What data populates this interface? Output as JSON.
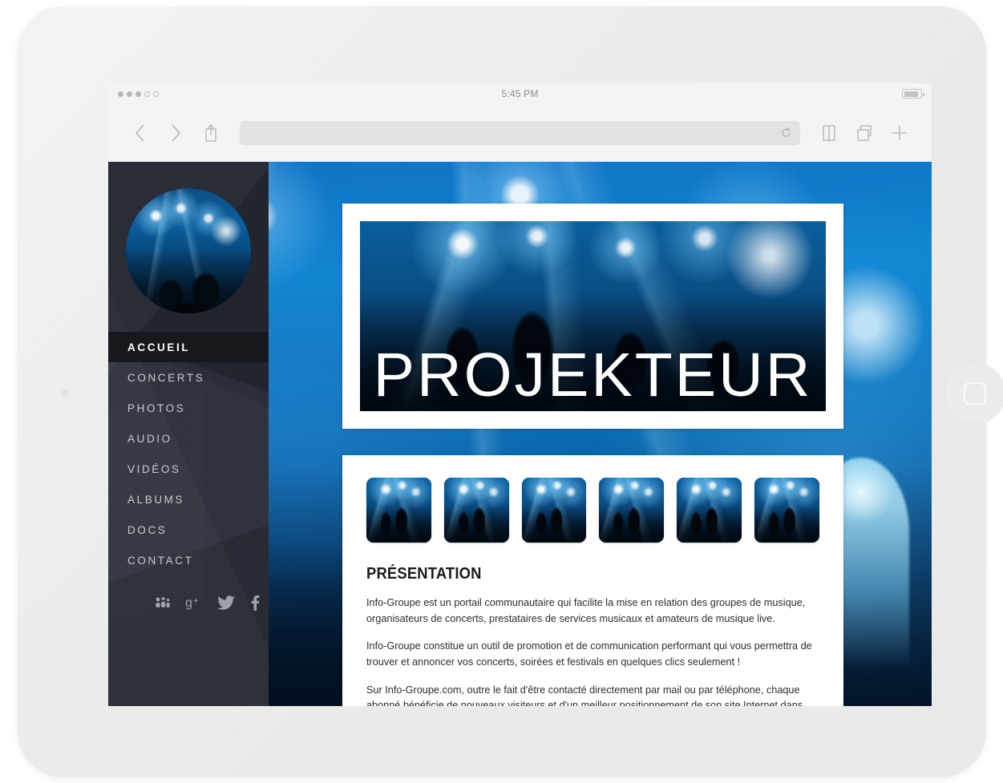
{
  "device": {
    "home_button": "home-button",
    "camera": "front-camera"
  },
  "browser": {
    "status": {
      "signal_filled": 3,
      "signal_total": 5,
      "time": "5:45 PM",
      "battery_level": "88%"
    },
    "toolbar": {
      "back": "back-chevron",
      "forward": "forward-chevron",
      "share": "share-icon",
      "url_value": "",
      "url_placeholder": "",
      "reload": "reload-icon",
      "bookmarks": "bookmarks-icon",
      "tabs": "tabs-icon",
      "new_tab": "plus-icon"
    }
  },
  "site": {
    "sidebar": {
      "avatar_alt": "band-logo-photo",
      "nav": [
        {
          "label": "ACCUEIL",
          "active": true
        },
        {
          "label": "CONCERTS",
          "active": false
        },
        {
          "label": "PHOTOS",
          "active": false
        },
        {
          "label": "AUDIO",
          "active": false
        },
        {
          "label": "VIDÉOS",
          "active": false
        },
        {
          "label": "ALBUMS",
          "active": false
        },
        {
          "label": "DOCS",
          "active": false
        },
        {
          "label": "CONTACT",
          "active": false
        }
      ],
      "social": [
        {
          "name": "myspace",
          "glyph": ""
        },
        {
          "name": "google-plus",
          "glyph": "g+"
        },
        {
          "name": "twitter",
          "glyph": ""
        },
        {
          "name": "facebook",
          "glyph": "f"
        }
      ]
    },
    "hero": {
      "title": "PROJEKTEUR"
    },
    "gallery": {
      "count": 6
    },
    "presentation": {
      "heading": "PRÉSENTATION",
      "paragraphs": [
        "Info-Groupe est un portail communautaire qui facilite la mise en relation des groupes de musique, organisateurs de concerts, prestataires de services musicaux et amateurs de musique live.",
        "Info-Groupe constitue un outil de promotion et de communication performant qui vous permettra de trouver et annoncer vos concerts, soirées et festivals en quelques clics seulement !",
        "Sur Info-Groupe.com, outre le fait d'être contacté directement par mail ou par téléphone, chaque abonné bénéficie de nouveaux visiteurs et d'un meilleur positionnement de son site Internet dans"
      ]
    }
  },
  "colors": {
    "sidebar_bg": "#2b2e3a",
    "sidebar_active_bg": "#17181e",
    "page_blue": "#0b6fb8",
    "device_body": "#eeeeee",
    "chrome_bg": "#f4f4f4"
  }
}
